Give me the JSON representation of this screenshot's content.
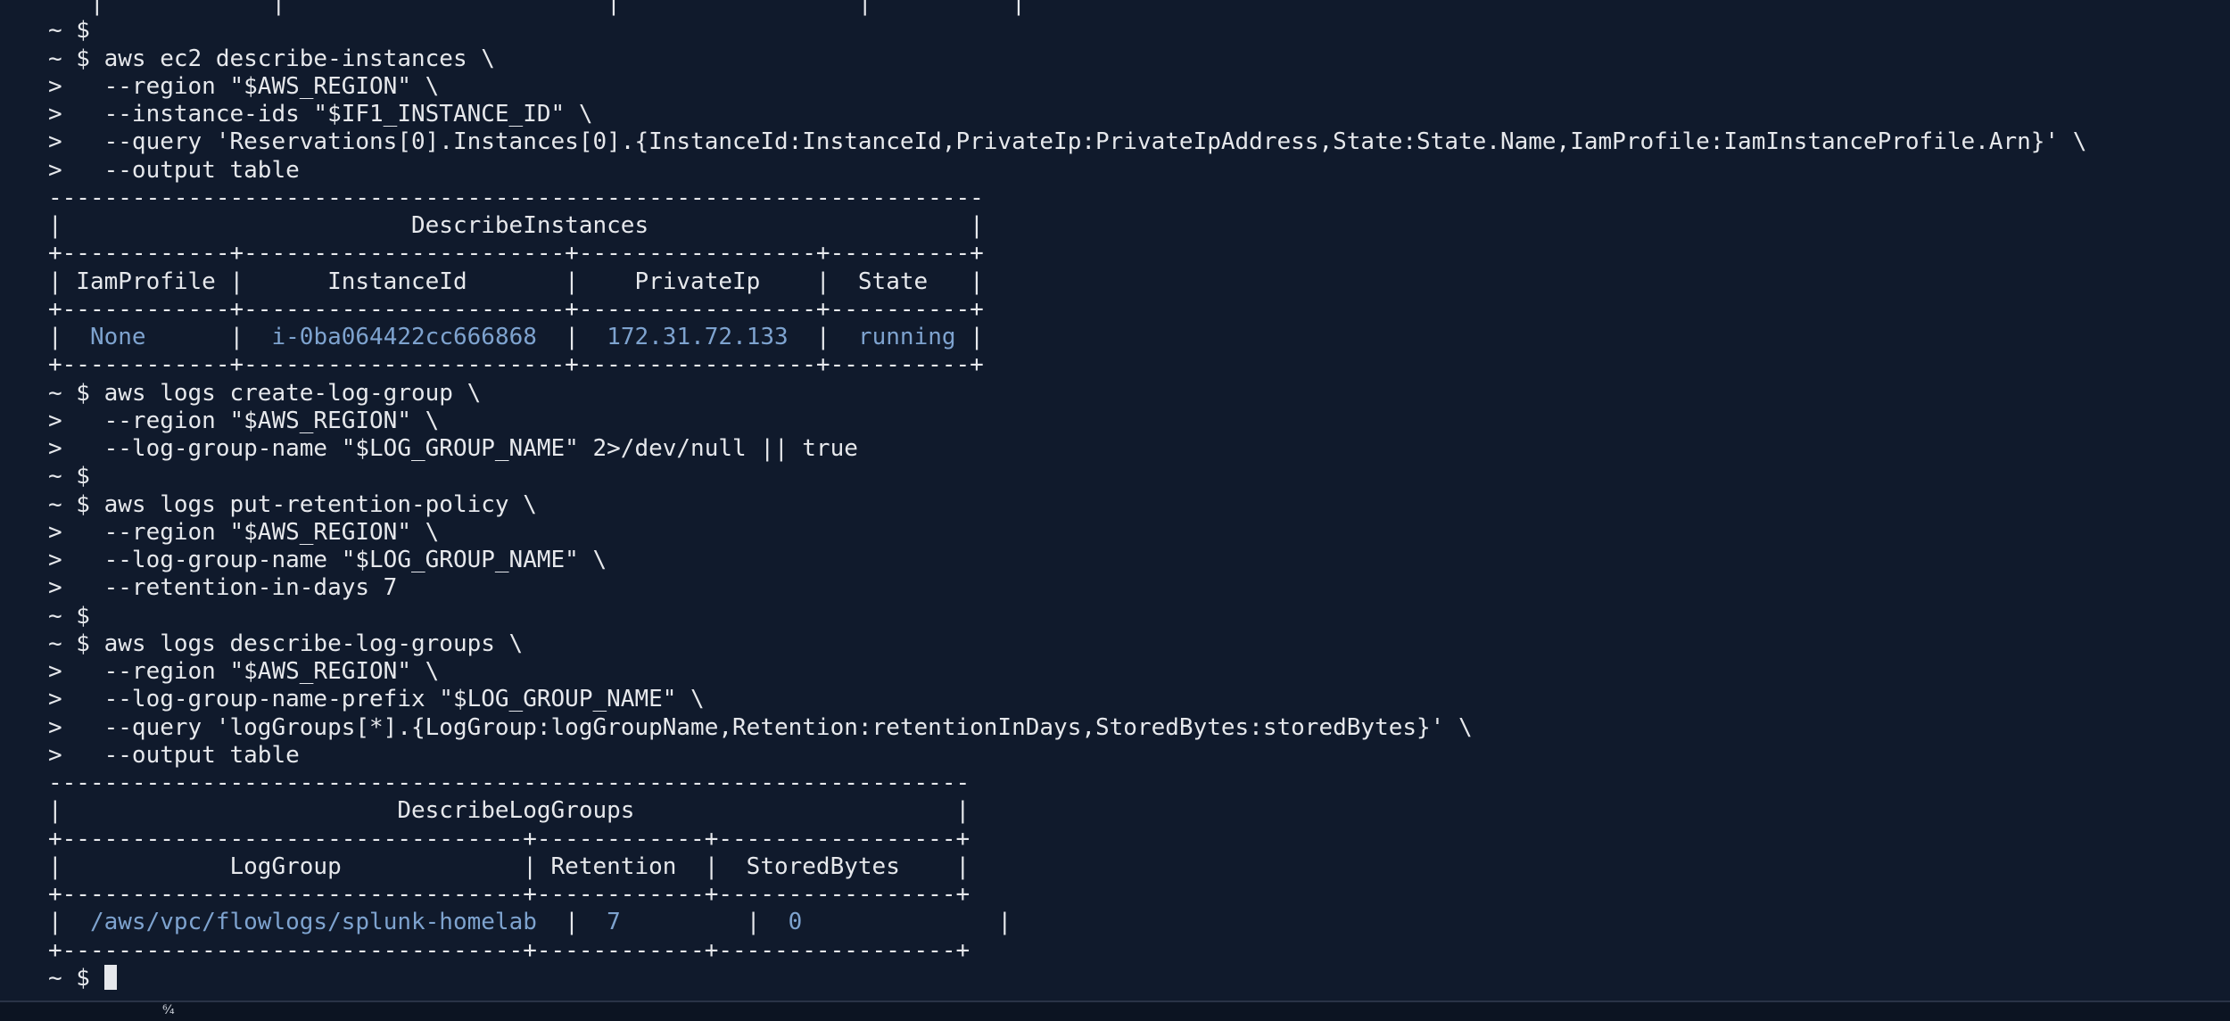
{
  "terminal": {
    "lines": [
      {
        "segments": [
          {
            "text": "   |            |                       |                 |          |"
          }
        ]
      },
      {
        "segments": [
          {
            "text": "~ $"
          }
        ]
      },
      {
        "segments": [
          {
            "text": "~ $ aws ec2 describe-instances \\"
          }
        ]
      },
      {
        "segments": [
          {
            "text": ">   --region \"$AWS_REGION\" \\"
          }
        ]
      },
      {
        "segments": [
          {
            "text": ">   --instance-ids \"$IF1_INSTANCE_ID\" \\"
          }
        ]
      },
      {
        "segments": [
          {
            "text": ">   --query 'Reservations[0].Instances[0].{InstanceId:InstanceId,PrivateIp:PrivateIpAddress,State:State.Name,IamProfile:IamInstanceProfile.Arn}' \\"
          }
        ]
      },
      {
        "segments": [
          {
            "text": ">   --output table"
          }
        ]
      },
      {
        "segments": [
          {
            "text": "-------------------------------------------------------------------"
          }
        ]
      },
      {
        "segments": [
          {
            "text": "|                         DescribeInstances                       |"
          }
        ]
      },
      {
        "segments": [
          {
            "text": "+------------+-----------------------+-----------------+----------+"
          }
        ]
      },
      {
        "segments": [
          {
            "text": "| IamProfile |      InstanceId       |    PrivateIp    |  State   |"
          }
        ]
      },
      {
        "segments": [
          {
            "text": "+------------+-----------------------+-----------------+----------+"
          }
        ]
      },
      {
        "segments": [
          {
            "text": "|  "
          },
          {
            "text": "None",
            "hl": true
          },
          {
            "text": "      |  "
          },
          {
            "text": "i-0ba064422cc666868",
            "hl": true
          },
          {
            "text": "  |  "
          },
          {
            "text": "172.31.72.133",
            "hl": true
          },
          {
            "text": "  |  "
          },
          {
            "text": "running",
            "hl": true
          },
          {
            "text": " |"
          }
        ]
      },
      {
        "segments": [
          {
            "text": "+------------+-----------------------+-----------------+----------+"
          }
        ]
      },
      {
        "segments": [
          {
            "text": "~ $ aws logs create-log-group \\"
          }
        ]
      },
      {
        "segments": [
          {
            "text": ">   --region \"$AWS_REGION\" \\"
          }
        ]
      },
      {
        "segments": [
          {
            "text": ">   --log-group-name \"$LOG_GROUP_NAME\" 2>/dev/null || true"
          }
        ]
      },
      {
        "segments": [
          {
            "text": "~ $"
          }
        ]
      },
      {
        "segments": [
          {
            "text": "~ $ aws logs put-retention-policy \\"
          }
        ]
      },
      {
        "segments": [
          {
            "text": ">   --region \"$AWS_REGION\" \\"
          }
        ]
      },
      {
        "segments": [
          {
            "text": ">   --log-group-name \"$LOG_GROUP_NAME\" \\"
          }
        ]
      },
      {
        "segments": [
          {
            "text": ">   --retention-in-days 7"
          }
        ]
      },
      {
        "segments": [
          {
            "text": "~ $"
          }
        ]
      },
      {
        "segments": [
          {
            "text": "~ $ aws logs describe-log-groups \\"
          }
        ]
      },
      {
        "segments": [
          {
            "text": ">   --region \"$AWS_REGION\" \\"
          }
        ]
      },
      {
        "segments": [
          {
            "text": ">   --log-group-name-prefix \"$LOG_GROUP_NAME\" \\"
          }
        ]
      },
      {
        "segments": [
          {
            "text": ">   --query 'logGroups[*].{LogGroup:logGroupName,Retention:retentionInDays,StoredBytes:storedBytes}' \\"
          }
        ]
      },
      {
        "segments": [
          {
            "text": ">   --output table"
          }
        ]
      },
      {
        "segments": [
          {
            "text": "------------------------------------------------------------------"
          }
        ]
      },
      {
        "segments": [
          {
            "text": "|                        DescribeLogGroups                       |"
          }
        ]
      },
      {
        "segments": [
          {
            "text": "+---------------------------------+------------+-----------------+"
          }
        ]
      },
      {
        "segments": [
          {
            "text": "|            LogGroup             | Retention  |  StoredBytes    |"
          }
        ]
      },
      {
        "segments": [
          {
            "text": "+---------------------------------+------------+-----------------+"
          }
        ]
      },
      {
        "segments": [
          {
            "text": "|  "
          },
          {
            "text": "/aws/vpc/flowlogs/splunk-homelab",
            "hl": true
          },
          {
            "text": "  |  "
          },
          {
            "text": "7",
            "hl": true
          },
          {
            "text": "         |  "
          },
          {
            "text": "0",
            "hl": true
          },
          {
            "text": "              |"
          }
        ]
      },
      {
        "segments": [
          {
            "text": "+---------------------------------+------------+-----------------+"
          }
        ]
      },
      {
        "segments": [
          {
            "text": "~ $ "
          }
        ],
        "cursor": true
      }
    ]
  },
  "statusbar": {
    "glyph": "⁶⁄₄"
  },
  "colors": {
    "background": "#101a2c",
    "text": "#e6e8ec",
    "value": "#7ea3cf"
  }
}
